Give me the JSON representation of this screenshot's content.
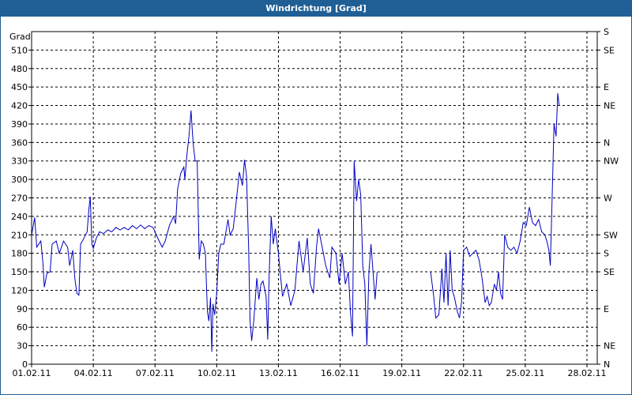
{
  "window": {
    "title": "Windrichtung [Grad]"
  },
  "chart_data": {
    "type": "line",
    "title": "Windrichtung [Grad]",
    "ylabel": "Grad",
    "xlabel": "",
    "ylim": [
      0,
      540
    ],
    "yticks": [
      0,
      30,
      60,
      90,
      120,
      150,
      180,
      210,
      240,
      270,
      300,
      330,
      360,
      390,
      420,
      450,
      480,
      510
    ],
    "xlim": [
      0,
      27.5
    ],
    "xticks": [
      {
        "pos": 0,
        "label": "01.02.11"
      },
      {
        "pos": 3,
        "label": "04.02.11"
      },
      {
        "pos": 6,
        "label": "07.02.11"
      },
      {
        "pos": 9,
        "label": "10.02.11"
      },
      {
        "pos": 12,
        "label": "13.02.11"
      },
      {
        "pos": 15,
        "label": "16.02.11"
      },
      {
        "pos": 18,
        "label": "19.02.11"
      },
      {
        "pos": 21,
        "label": "22.02.11"
      },
      {
        "pos": 24,
        "label": "25.02.11"
      },
      {
        "pos": 27,
        "label": "28.02.11"
      }
    ],
    "right_axis_labels": [
      {
        "value": 0,
        "label": "N"
      },
      {
        "value": 30,
        "label": "NE"
      },
      {
        "value": 90,
        "label": "E"
      },
      {
        "value": 150,
        "label": "SE"
      },
      {
        "value": 180,
        "label": "S"
      },
      {
        "value": 210,
        "label": "SW"
      },
      {
        "value": 270,
        "label": "W"
      },
      {
        "value": 330,
        "label": "NW"
      },
      {
        "value": 360,
        "label": "N"
      },
      {
        "value": 420,
        "label": "NE"
      },
      {
        "value": 450,
        "label": "E"
      },
      {
        "value": 510,
        "label": "SE"
      },
      {
        "value": 540,
        "label": "S"
      }
    ],
    "grid": true,
    "line_color": "#0000c0",
    "series": [
      {
        "name": "",
        "segments": [
          [
            [
              0.0,
              210
            ],
            [
              0.15,
              238
            ],
            [
              0.25,
              190
            ],
            [
              0.45,
              200
            ],
            [
              0.55,
              165
            ],
            [
              0.62,
              125
            ],
            [
              0.75,
              148
            ],
            [
              0.9,
              150
            ],
            [
              1.0,
              195
            ],
            [
              1.2,
              200
            ],
            [
              1.35,
              180
            ],
            [
              1.55,
              200
            ],
            [
              1.75,
              190
            ],
            [
              1.85,
              160
            ],
            [
              2.0,
              185
            ],
            [
              2.1,
              140
            ],
            [
              2.2,
              115
            ],
            [
              2.3,
              112
            ],
            [
              2.38,
              195
            ],
            [
              2.55,
              205
            ],
            [
              2.7,
              215
            ],
            [
              2.78,
              250
            ],
            [
              2.85,
              272
            ],
            [
              2.93,
              195
            ],
            [
              3.0,
              188
            ],
            [
              3.15,
              205
            ],
            [
              3.3,
              215
            ],
            [
              3.5,
              212
            ],
            [
              3.7,
              218
            ],
            [
              3.9,
              215
            ],
            [
              4.1,
              222
            ],
            [
              4.3,
              218
            ],
            [
              4.5,
              222
            ],
            [
              4.7,
              218
            ],
            [
              4.9,
              225
            ],
            [
              5.1,
              220
            ],
            [
              5.3,
              226
            ],
            [
              5.5,
              220
            ],
            [
              5.7,
              225
            ],
            [
              5.9,
              222
            ],
            [
              6.0,
              215
            ],
            [
              6.2,
              200
            ],
            [
              6.35,
              190
            ],
            [
              6.5,
              200
            ],
            [
              6.7,
              225
            ],
            [
              6.9,
              240
            ],
            [
              7.0,
              228
            ],
            [
              7.1,
              285
            ],
            [
              7.25,
              310
            ],
            [
              7.4,
              320
            ],
            [
              7.45,
              300
            ],
            [
              7.55,
              340
            ],
            [
              7.65,
              370
            ],
            [
              7.75,
              412
            ],
            [
              7.85,
              360
            ],
            [
              7.95,
              330
            ],
            [
              8.05,
              330
            ],
            [
              8.15,
              170
            ],
            [
              8.25,
              200
            ],
            [
              8.35,
              195
            ],
            [
              8.45,
              180
            ],
            [
              8.5,
              130
            ],
            [
              8.55,
              85
            ],
            [
              8.62,
              70
            ],
            [
              8.7,
              108
            ],
            [
              8.76,
              20
            ],
            [
              8.82,
              98
            ],
            [
              8.9,
              80
            ],
            [
              9.0,
              115
            ],
            [
              9.1,
              180
            ],
            [
              9.2,
              195
            ],
            [
              9.35,
              195
            ],
            [
              9.55,
              235
            ],
            [
              9.65,
              210
            ],
            [
              9.8,
              220
            ],
            [
              9.95,
              265
            ],
            [
              10.1,
              312
            ],
            [
              10.25,
              290
            ],
            [
              10.35,
              332
            ],
            [
              10.45,
              305
            ],
            [
              10.55,
              190
            ],
            [
              10.62,
              70
            ],
            [
              10.7,
              38
            ],
            [
              10.8,
              70
            ],
            [
              10.95,
              140
            ],
            [
              11.05,
              105
            ],
            [
              11.15,
              130
            ],
            [
              11.25,
              135
            ],
            [
              11.4,
              110
            ],
            [
              11.48,
              40
            ],
            [
              11.55,
              145
            ],
            [
              11.65,
              240
            ],
            [
              11.75,
              195
            ],
            [
              11.85,
              220
            ],
            [
              12.0,
              180
            ],
            [
              12.2,
              110
            ],
            [
              12.4,
              130
            ],
            [
              12.6,
              95
            ],
            [
              12.8,
              120
            ],
            [
              13.0,
              200
            ],
            [
              13.2,
              150
            ],
            [
              13.4,
              205
            ],
            [
              13.55,
              130
            ],
            [
              13.7,
              115
            ],
            [
              13.85,
              190
            ],
            [
              13.95,
              220
            ],
            [
              14.1,
              195
            ],
            [
              14.3,
              160
            ],
            [
              14.5,
              140
            ],
            [
              14.6,
              190
            ],
            [
              14.8,
              180
            ],
            [
              14.95,
              130
            ],
            [
              15.1,
              180
            ],
            [
              15.25,
              130
            ],
            [
              15.4,
              150
            ],
            [
              15.5,
              85
            ],
            [
              15.6,
              45
            ],
            [
              15.68,
              330
            ],
            [
              15.8,
              265
            ],
            [
              15.9,
              300
            ],
            [
              16.0,
              275
            ],
            [
              16.1,
              160
            ],
            [
              16.2,
              130
            ],
            [
              16.3,
              30
            ],
            [
              16.4,
              150
            ],
            [
              16.5,
              195
            ],
            [
              16.6,
              150
            ],
            [
              16.7,
              105
            ],
            [
              16.8,
              150
            ]
          ],
          [
            [
              19.4,
              150
            ],
            [
              19.55,
              110
            ],
            [
              19.65,
              75
            ],
            [
              19.8,
              80
            ],
            [
              19.95,
              155
            ],
            [
              20.05,
              100
            ],
            [
              20.15,
              180
            ],
            [
              20.25,
              95
            ],
            [
              20.35,
              185
            ],
            [
              20.45,
              120
            ],
            [
              20.55,
              110
            ],
            [
              20.7,
              85
            ],
            [
              20.8,
              75
            ],
            [
              20.9,
              100
            ],
            [
              21.0,
              185
            ],
            [
              21.15,
              190
            ],
            [
              21.3,
              175
            ],
            [
              21.45,
              180
            ],
            [
              21.6,
              185
            ],
            [
              21.75,
              170
            ],
            [
              21.9,
              140
            ],
            [
              22.05,
              100
            ],
            [
              22.15,
              110
            ],
            [
              22.25,
              95
            ],
            [
              22.35,
              100
            ],
            [
              22.5,
              130
            ],
            [
              22.6,
              120
            ],
            [
              22.7,
              150
            ],
            [
              22.8,
              115
            ],
            [
              22.9,
              105
            ],
            [
              23.0,
              210
            ],
            [
              23.15,
              190
            ],
            [
              23.3,
              185
            ],
            [
              23.45,
              190
            ],
            [
              23.6,
              180
            ],
            [
              23.75,
              200
            ],
            [
              23.9,
              230
            ],
            [
              24.05,
              225
            ],
            [
              24.2,
              255
            ],
            [
              24.35,
              230
            ],
            [
              24.5,
              225
            ],
            [
              24.65,
              235
            ],
            [
              24.8,
              215
            ],
            [
              24.95,
              210
            ],
            [
              25.05,
              200
            ],
            [
              25.15,
              185
            ],
            [
              25.22,
              160
            ],
            [
              25.3,
              260
            ],
            [
              25.4,
              390
            ],
            [
              25.5,
              370
            ],
            [
              25.58,
              440
            ],
            [
              25.65,
              420
            ]
          ]
        ]
      }
    ]
  }
}
